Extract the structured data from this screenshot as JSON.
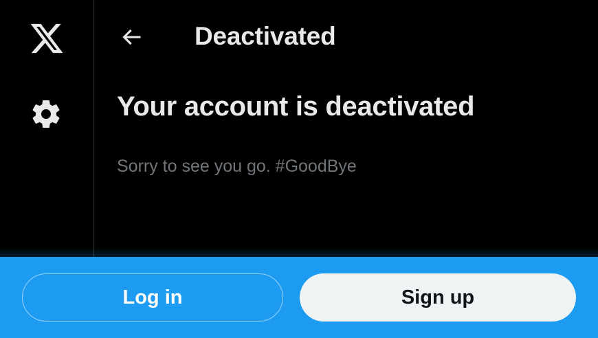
{
  "header": {
    "title": "Deactivated",
    "back_icon": "arrow-left-icon"
  },
  "sidebar": {
    "logo_icon": "x-logo-icon",
    "settings_icon": "gear-icon"
  },
  "main": {
    "headline": "Your account is deactivated",
    "subtitle": "Sorry to see you go. #GoodBye"
  },
  "bottom_bar": {
    "login_label": "Log in",
    "signup_label": "Sign up",
    "background_color": "#1d9bf0"
  },
  "colors": {
    "background": "#000000",
    "primary_text": "#e7e9ea",
    "secondary_text": "#71767b",
    "accent": "#1d9bf0",
    "signup_button_bg": "#eff3f4"
  }
}
